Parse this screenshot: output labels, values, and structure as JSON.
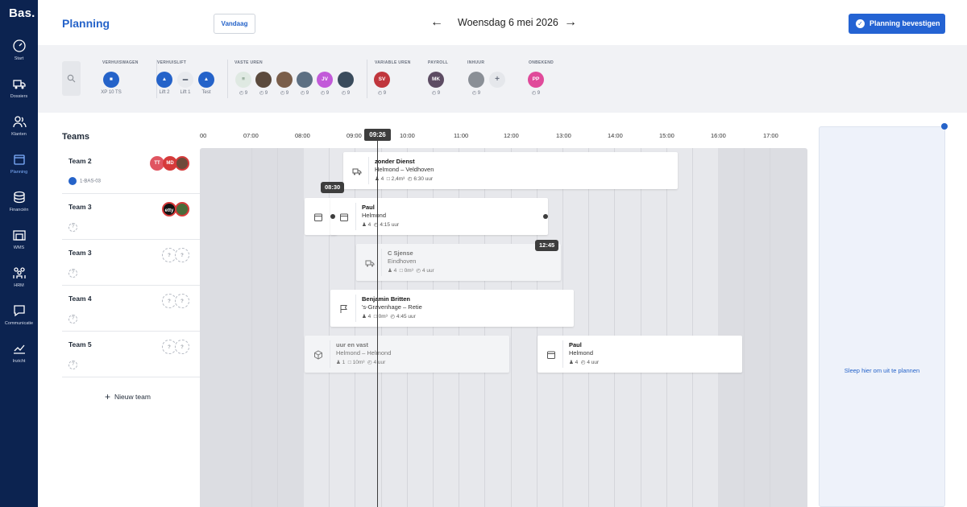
{
  "app": {
    "logo": "Bas."
  },
  "sidebar": {
    "items": [
      {
        "label": "Start",
        "icon": "gauge-icon"
      },
      {
        "label": "Dossiers",
        "icon": "truck-icon"
      },
      {
        "label": "Klanten",
        "icon": "users-icon"
      },
      {
        "label": "Planning",
        "icon": "calendar-icon",
        "active": true
      },
      {
        "label": "Financiën",
        "icon": "coins-icon"
      },
      {
        "label": "WMS",
        "icon": "warehouse-icon"
      },
      {
        "label": "HRM",
        "icon": "people-icon"
      },
      {
        "label": "Communicatie",
        "icon": "chat-icon"
      },
      {
        "label": "Inzicht",
        "icon": "chart-icon"
      }
    ]
  },
  "header": {
    "title": "Planning",
    "today_label": "Vandaag",
    "date": "Woensdag 6 mei 2026",
    "prev_icon": "arrow-left-icon",
    "next_icon": "arrow-right-icon",
    "confirm_label": "Planning bevestigen"
  },
  "resources": {
    "groups": [
      {
        "label": "VERHUISWAGEN"
      },
      {
        "label": "VERHUISLIFT"
      },
      {
        "label": "VASTE UREN"
      },
      {
        "label": "VARIABLE UREN"
      },
      {
        "label": "PAYROLL"
      },
      {
        "label": "INHUUR"
      },
      {
        "label": "ONBEKEND"
      }
    ],
    "verhuiswagen": [
      {
        "caption": "XP 10 TS",
        "color": "#2563c9"
      }
    ],
    "verhuislift": [
      {
        "caption": "Lift 2",
        "color": "#2563c9"
      },
      {
        "caption": "Lift 1",
        "color": "#9aa3b1"
      },
      {
        "caption": "Test",
        "color": "#2563c9"
      }
    ],
    "vaste": [
      {
        "initials": "",
        "count": "9",
        "color": "#9bb7a0"
      },
      {
        "initials": "",
        "count": "9",
        "color": "#5b4a3d"
      },
      {
        "initials": "",
        "count": "9",
        "color": "#7a5e4a"
      },
      {
        "initials": "",
        "count": "9",
        "color": "#5d7083"
      },
      {
        "initials": "JV",
        "count": "9",
        "color": "#c25ad9"
      },
      {
        "initials": "",
        "count": "9",
        "color": "#3a4b5c"
      }
    ],
    "variable": [
      {
        "initials": "SV",
        "count": "9",
        "color": "#c0363d"
      }
    ],
    "payroll": [
      {
        "initials": "MK",
        "count": "9",
        "color": "#5d4c63"
      }
    ],
    "inhuur": [
      {
        "initials": "",
        "count": "9",
        "color": "#8a8f96"
      }
    ],
    "onbekend": [
      {
        "initials": "PP",
        "count": "9",
        "color": "#e04a9a"
      }
    ]
  },
  "teams": {
    "title": "Teams",
    "rows": [
      {
        "name": "Team 2",
        "sub": "1-BAS-03",
        "avatars": [
          "TT",
          "MD",
          ""
        ]
      },
      {
        "name": "Team 3",
        "sub": "?",
        "avatars": [
          "etty",
          ""
        ]
      },
      {
        "name": "Team 3",
        "sub": "?",
        "avatars": [
          "?",
          "?"
        ]
      },
      {
        "name": "Team 4",
        "sub": "?",
        "avatars": [
          "?",
          "?"
        ]
      },
      {
        "name": "Team 5",
        "sub": "?",
        "avatars": [
          "?",
          "?"
        ]
      }
    ],
    "new_team_label": "Nieuw team"
  },
  "timeline": {
    "hours": [
      "00",
      "07:00",
      "08:00",
      "09:00",
      "10:00",
      "11:00",
      "12:00",
      "13:00",
      "14:00",
      "15:00",
      "16:00",
      "17:00"
    ],
    "now": "09:26",
    "badges": [
      "08:30",
      "12:45"
    ]
  },
  "cards": [
    {
      "title": "zonder Dienst",
      "route": "Helmond – Veldhoven",
      "persons": "4",
      "volume": "2,4m³",
      "duration": "6:30 uur",
      "icon": "truck-icon"
    },
    {
      "title": "Paul",
      "route": "Helmond",
      "persons": "4",
      "volume": "",
      "duration": "4:15 uur",
      "icon": "calendar-icon"
    },
    {
      "title": "C Sjense",
      "route": "Eindhoven",
      "persons": "4",
      "volume": "0m³",
      "duration": "4 uur",
      "icon": "truck-icon"
    },
    {
      "title": "Benjamin Britten",
      "route": "'s-Gravenhage – Retie",
      "persons": "4",
      "volume": "0m³",
      "duration": "4:45 uur",
      "icon": "flag-icon"
    },
    {
      "title": "uur en vast",
      "route": "Helmond – Helmond",
      "persons": "1",
      "volume": "10m³",
      "duration": "4 uur",
      "icon": "box-icon"
    },
    {
      "title": "Paul",
      "route": "Helmond",
      "persons": "4",
      "volume": "",
      "duration": "4 uur",
      "icon": "calendar-icon"
    }
  ],
  "unplanned": {
    "text": "Sleep hier om uit te plannen"
  },
  "colors": {
    "sidebar": "#0c2350",
    "accent": "#2563c9",
    "grid": "#dcdde2"
  }
}
